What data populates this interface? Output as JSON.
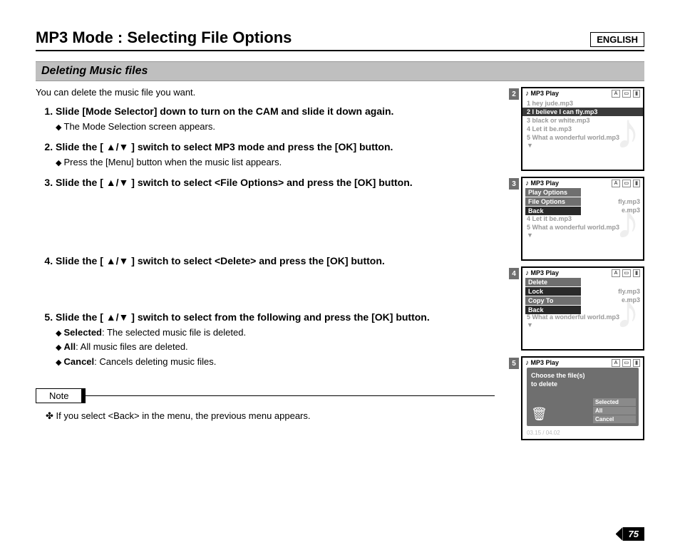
{
  "header": {
    "title": "MP3 Mode : Selecting File Options",
    "language": "ENGLISH"
  },
  "subtitle": "Deleting Music files",
  "intro": "You can delete the music file you want.",
  "steps": {
    "s1": {
      "text": "Slide [Mode Selector] down to turn on the CAM and slide it down again.",
      "sub1": "The Mode Selection screen appears."
    },
    "s2": {
      "text": "Slide the [ ▲/▼ ] switch to select MP3 mode and press the [OK] button.",
      "sub1": "Press the [Menu] button when the music list appears."
    },
    "s3": {
      "text": "Slide the [ ▲/▼ ] switch to select <File Options> and press the [OK] button."
    },
    "s4": {
      "text": "Slide the [ ▲/▼ ] switch to select <Delete> and press the [OK] button."
    },
    "s5": {
      "text": "Slide the [ ▲/▼ ] switch to select from the following and press the [OK] button.",
      "sub1_label": "Selected",
      "sub1_desc": ": The selected music file is deleted.",
      "sub2_label": "All",
      "sub2_desc": ": All music files are deleted.",
      "sub3_label": "Cancel",
      "sub3_desc": ": Cancels deleting music files."
    }
  },
  "note": {
    "label": "Note",
    "body": "If you select <Back> in the menu, the previous menu appears."
  },
  "screens": {
    "head_title": "MP3 Play",
    "songs": {
      "r1": "1  hey jude.mp3",
      "r2": "2  I believe I can fly.mp3",
      "r3": "3  black or white.mp3",
      "r4": "4  Let it be.mp3",
      "r5": "5  What a wonderful world.mp3"
    },
    "ghost": {
      "g2": "fly.mp3",
      "g3": "e.mp3"
    },
    "menu1": {
      "m1": "Play Options",
      "m2": "File Options",
      "m3": "Back"
    },
    "menu2": {
      "m1": "Delete",
      "m2": "Lock",
      "m3": "Copy To",
      "m4": "Back"
    },
    "dialog": {
      "line1": "Choose the file(s)",
      "line2": "to delete",
      "o1": "Selected",
      "o2": "All",
      "o3": "Cancel",
      "timecode": "03.15 / 04.02"
    },
    "step_labels": {
      "n2": "2",
      "n3": "3",
      "n4": "4",
      "n5": "5"
    }
  },
  "page_number": "75"
}
